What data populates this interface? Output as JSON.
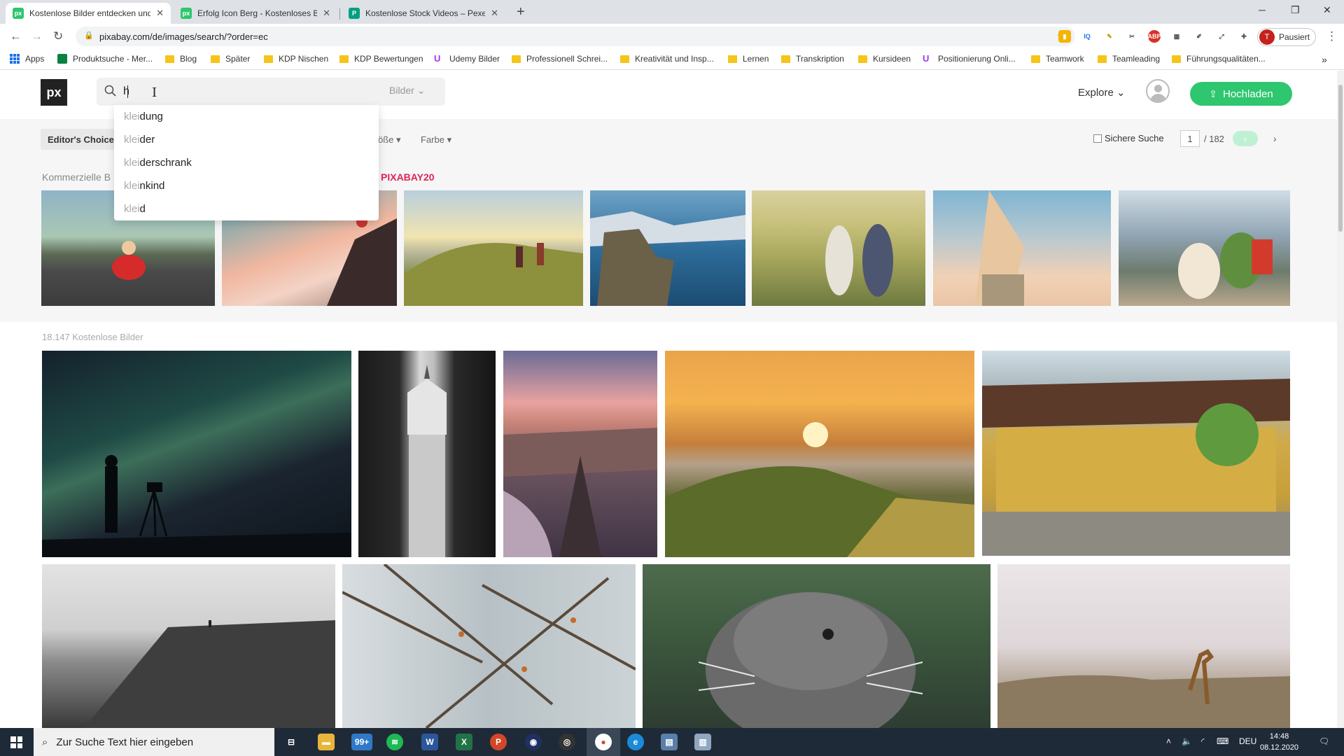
{
  "browser": {
    "tabs": [
      {
        "title": "Kostenlose Bilder entdecken und",
        "favicon": "pixabay-favicon",
        "active": true
      },
      {
        "title": "Erfolg Icon Berg - Kostenloses Bi",
        "favicon": "pixabay-favicon",
        "active": false
      },
      {
        "title": "Kostenlose Stock Videos – Pexels",
        "favicon": "pexels-favicon",
        "active": false
      }
    ],
    "url": "pixabay.com/de/images/search/?order=ec",
    "profile_label": "Pausiert",
    "profile_initial": "T",
    "bookmarks": [
      "Apps",
      "Produktsuche - Mer...",
      "Blog",
      "Später",
      "KDP Nischen",
      "KDP Bewertungen",
      "Udemy Bilder",
      "Professionell Schrei...",
      "Kreativität und Insp...",
      "Lernen",
      "Transkription",
      "Kursideen",
      "Positionierung Onli...",
      "Teamwork",
      "Teamleading",
      "Führungsqualitäten..."
    ]
  },
  "site": {
    "logo": "px",
    "search": {
      "value": "h",
      "type_label": "Bilder"
    },
    "explore": "Explore",
    "upload": "Hochladen",
    "suggestions": [
      {
        "prefix": "klei",
        "rest": "dung"
      },
      {
        "prefix": "klei",
        "rest": "der"
      },
      {
        "prefix": "klei",
        "rest": "derschrank"
      },
      {
        "prefix": "klei",
        "rest": "nkind"
      },
      {
        "prefix": "klei",
        "rest": "d"
      }
    ],
    "filters": {
      "editors_choice": "Editor's Choice",
      "size": "öße",
      "color": "Farbe",
      "safe_search": "Sichere Suche",
      "page": "1",
      "page_total": "/ 182"
    },
    "sponsored_label": "Kommerzielle B",
    "sponsored_code": "PIXABAY20",
    "count": "18.147 Kostenlose Bilder"
  },
  "taskbar": {
    "search_placeholder": "Zur Suche Text hier eingeben",
    "language": "DEU",
    "time": "14:48",
    "date": "08.12.2020",
    "mail_badge": "99+"
  }
}
